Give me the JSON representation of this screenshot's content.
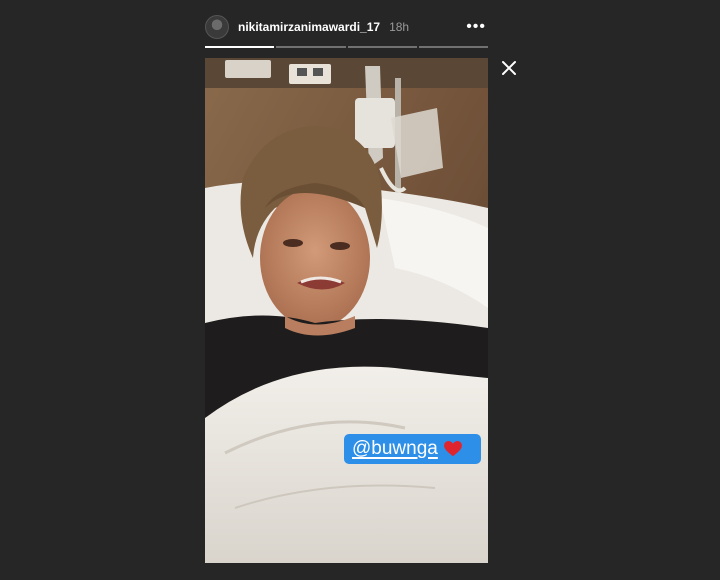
{
  "header": {
    "username": "nikitamirzanimawardi_17",
    "time_ago": "18h",
    "more_label": "•••"
  },
  "progress": {
    "segments": [
      {
        "filled": 1.0
      },
      {
        "filled": 0.0
      },
      {
        "filled": 0.0
      },
      {
        "filled": 0.0
      }
    ]
  },
  "sticker": {
    "mention": "@buwnga",
    "emoji": "heart-icon"
  },
  "icons": {
    "close": "close-icon",
    "more": "more-options-icon",
    "avatar": "avatar"
  },
  "colors": {
    "background": "#262626",
    "mention_bg": "#2e8fe8",
    "heart": "#e0242e"
  }
}
